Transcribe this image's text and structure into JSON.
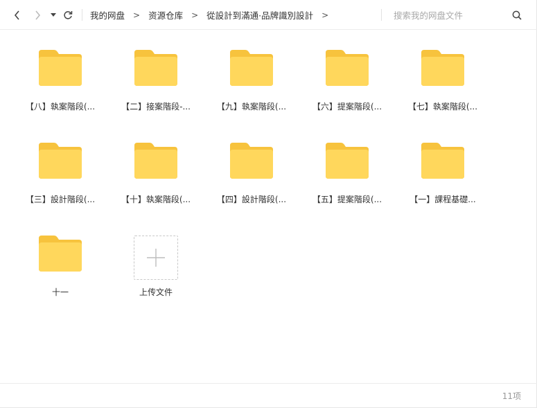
{
  "breadcrumb": {
    "items": [
      "我的网盘",
      "资源仓库",
      "從設計到滿通·品牌識別設計"
    ],
    "separator": ">"
  },
  "search": {
    "placeholder": "搜索我的网盘文件"
  },
  "folders": [
    {
      "name": "【八】執案階段(..."
    },
    {
      "name": "【二】接案階段-..."
    },
    {
      "name": "【九】執案階段(..."
    },
    {
      "name": "【六】提案階段(..."
    },
    {
      "name": "【七】執案階段(..."
    },
    {
      "name": "【三】設計階段(..."
    },
    {
      "name": "【十】執案階段(..."
    },
    {
      "name": "【四】設計階段(..."
    },
    {
      "name": "【五】提案階段(..."
    },
    {
      "name": "【一】課程基礎..."
    },
    {
      "name": "十一"
    }
  ],
  "upload": {
    "label": "上传文件"
  },
  "footer": {
    "count": "11项"
  },
  "colors": {
    "folder_body": "#FFD75C",
    "folder_tab": "#F7C33D",
    "accent_icon": "#555555"
  }
}
